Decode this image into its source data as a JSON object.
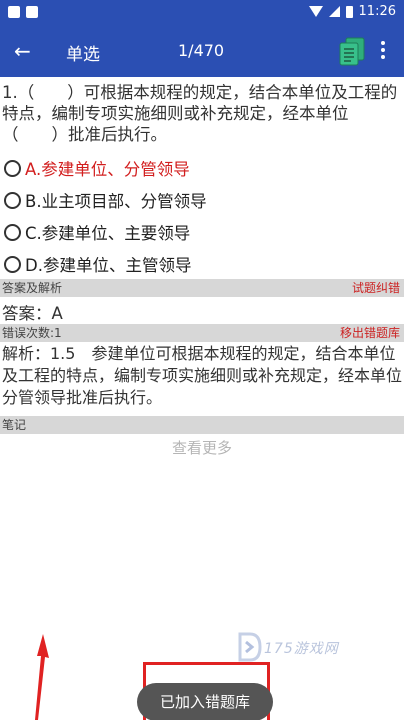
{
  "status_bar": {
    "time": "11:26"
  },
  "toolbar": {
    "title": "单选",
    "counter": "1/470"
  },
  "question": {
    "text": "1.（　　）可根据本规程的规定，结合本单位及工程的特点，编制专项实施细则或补充规定，经本单位（　　）批准后执行。"
  },
  "options": [
    {
      "label": "A.参建单位、分管领导",
      "correct": true
    },
    {
      "label": "B.业主项目部、分管领导",
      "correct": false
    },
    {
      "label": "C.参建单位、主要领导",
      "correct": false
    },
    {
      "label": "D.参建单位、主管领导",
      "correct": false
    }
  ],
  "answer_section": {
    "header": "答案及解析",
    "report_error": "试题纠错",
    "answer": "答案：A"
  },
  "error_section": {
    "count_label": "错误次数:1",
    "remove_label": "移出错题库"
  },
  "analysis": {
    "text": "解析：1.5　参建单位可根据本规程的规定，结合本单位及工程的特点，编制专项实施细则或补充规定，经本单位分管领导批准后执行。"
  },
  "notes": {
    "header": "笔记",
    "see_more": "查看更多"
  },
  "watermark": {
    "text": "175游戏网"
  },
  "toast": {
    "text": "已加入错题库"
  },
  "colors": {
    "toolbar": "#2b4fb3",
    "correct": "#d21e1e",
    "link": "#cc2222",
    "toast": "#555555"
  }
}
